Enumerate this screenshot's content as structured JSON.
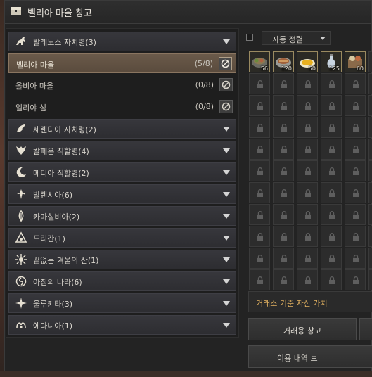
{
  "window": {
    "title": "벨리아 마을 창고"
  },
  "regions_top": {
    "label": "발레노스 자치령(3)",
    "towns": [
      {
        "name": "벨리아 마을",
        "count": "(5/8)",
        "active": true
      },
      {
        "name": "올비아 마을",
        "count": "(0/8)",
        "active": false
      },
      {
        "name": "일리야 섬",
        "count": "(0/8)",
        "active": false
      }
    ]
  },
  "regions": [
    {
      "label": "세렌디아 자치령(2)",
      "icon": "serendia-icon"
    },
    {
      "label": "칼페온 직할령(4)",
      "icon": "calpheon-icon"
    },
    {
      "label": "메디아 직할령(2)",
      "icon": "mediah-icon"
    },
    {
      "label": "발렌시아(6)",
      "icon": "valencia-icon"
    },
    {
      "label": "카마실비아(2)",
      "icon": "kamasylvia-icon"
    },
    {
      "label": "드리간(1)",
      "icon": "drieghan-icon"
    },
    {
      "label": "끝없는 겨울의 산(1)",
      "icon": "mountain-of-eternal-winter-icon"
    },
    {
      "label": "아침의 나라(6)",
      "icon": "land-of-morning-light-icon"
    },
    {
      "label": "울루키타(3)",
      "icon": "ulukita-icon"
    },
    {
      "label": "에다니아(1)",
      "icon": "edania-icon"
    }
  ],
  "sort": {
    "label": "자동 정렬"
  },
  "items": [
    {
      "name": "cooked-dish-icon",
      "qty": "56"
    },
    {
      "name": "stew-bowl-icon",
      "qty": "120"
    },
    {
      "name": "omelet-plate-icon",
      "qty": "50"
    },
    {
      "name": "potion-flask-icon",
      "qty": "125"
    },
    {
      "name": "meal-set-icon",
      "qty": "60"
    }
  ],
  "asset_label": "거래소 기준 자산 가치",
  "buttons": {
    "market_storage": "거래용 창고",
    "usage_history": "이용 내역 보"
  },
  "colors": {
    "accent_gold": "#e0b060",
    "active_row": "#6a5a4a"
  }
}
